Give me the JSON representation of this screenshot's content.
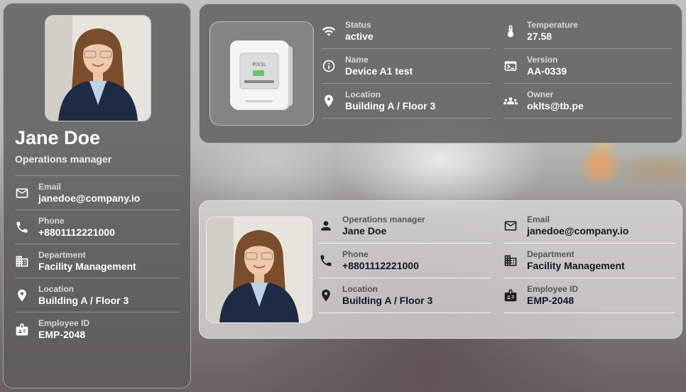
{
  "profile": {
    "name": "Jane Doe",
    "role": "Operations manager",
    "email_label": "Email",
    "email": "janedoe@company.io",
    "phone_label": "Phone",
    "phone": "+8801112221000",
    "department_label": "Department",
    "department": "Facility Management",
    "location_label": "Location",
    "location": "Building A / Floor 3",
    "employee_id_label": "Employee ID",
    "employee_id": "EMP-2048"
  },
  "device": {
    "screen_text": "PIX3L",
    "status_label": "Status",
    "status": "active",
    "temperature_label": "Temperature",
    "temperature": "27.58",
    "name_label": "Name",
    "name": "Device A1 test",
    "version_label": "Version",
    "version": "AA-0339",
    "location_label": "Location",
    "location": "Building A / Floor 3",
    "owner_label": "Owner",
    "owner": "oklts@tb.pe"
  },
  "employee_card": {
    "role_label": "Operations manager",
    "name": "Jane Doe",
    "email_label": "Email",
    "email": "janedoe@company.io",
    "phone_label": "Phone",
    "phone": "+8801112221000",
    "department_label": "Department",
    "department": "Facility Management",
    "location_label": "Location",
    "location": "Building A / Floor 3",
    "employee_id_label": "Employee ID",
    "employee_id": "EMP-2048"
  },
  "icons": {
    "email": "mail-icon",
    "phone": "phone-icon",
    "department": "building-icon",
    "location": "location-pin-icon",
    "employee_id": "badge-icon",
    "status": "wifi-icon",
    "temperature": "thermometer-icon",
    "name": "info-icon",
    "version": "terminal-icon",
    "owner": "group-icon",
    "person": "person-icon"
  }
}
